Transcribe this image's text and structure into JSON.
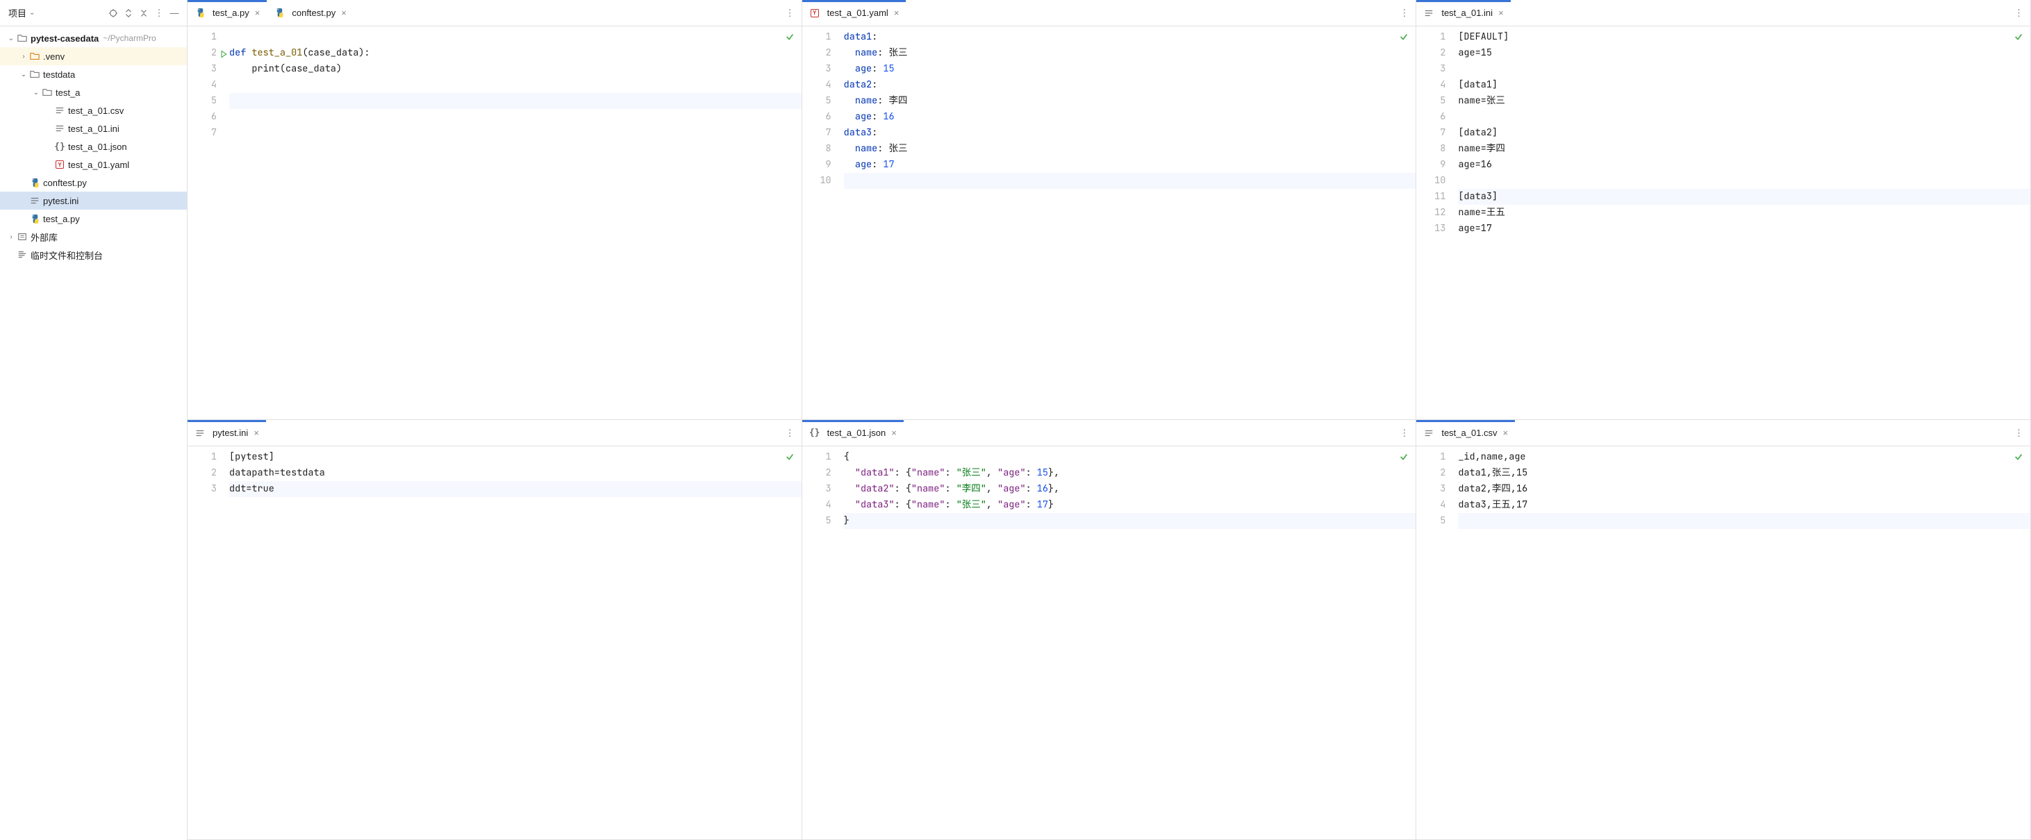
{
  "sidebar": {
    "title": "项目",
    "tree": [
      {
        "id": "root",
        "indent": 0,
        "caret": "open",
        "icon": "folder",
        "label": "pytest-casedata",
        "bold": true,
        "suffix": "~/PycharmPro",
        "hl": false,
        "sel": false
      },
      {
        "id": "venv",
        "indent": 1,
        "caret": "closed",
        "icon": "folder-exc",
        "label": ".venv",
        "bold": false,
        "suffix": "",
        "hl": true,
        "sel": false
      },
      {
        "id": "testdata",
        "indent": 1,
        "caret": "open",
        "icon": "folder",
        "label": "testdata",
        "bold": false,
        "suffix": "",
        "hl": false,
        "sel": false
      },
      {
        "id": "test_a",
        "indent": 2,
        "caret": "open",
        "icon": "folder",
        "label": "test_a",
        "bold": false,
        "suffix": "",
        "hl": false,
        "sel": false
      },
      {
        "id": "csv",
        "indent": 3,
        "caret": "",
        "icon": "lines",
        "label": "test_a_01.csv",
        "bold": false,
        "suffix": "",
        "hl": false,
        "sel": false
      },
      {
        "id": "ini",
        "indent": 3,
        "caret": "",
        "icon": "lines",
        "label": "test_a_01.ini",
        "bold": false,
        "suffix": "",
        "hl": false,
        "sel": false
      },
      {
        "id": "json",
        "indent": 3,
        "caret": "",
        "icon": "json",
        "label": "test_a_01.json",
        "bold": false,
        "suffix": "",
        "hl": false,
        "sel": false
      },
      {
        "id": "yaml",
        "indent": 3,
        "caret": "",
        "icon": "yaml",
        "label": "test_a_01.yaml",
        "bold": false,
        "suffix": "",
        "hl": false,
        "sel": false
      },
      {
        "id": "conftest",
        "indent": 1,
        "caret": "",
        "icon": "py",
        "label": "conftest.py",
        "bold": false,
        "suffix": "",
        "hl": false,
        "sel": false
      },
      {
        "id": "pytestini",
        "indent": 1,
        "caret": "",
        "icon": "lines",
        "label": "pytest.ini",
        "bold": false,
        "suffix": "",
        "hl": false,
        "sel": true
      },
      {
        "id": "test_a_py",
        "indent": 1,
        "caret": "",
        "icon": "py",
        "label": "test_a.py",
        "bold": false,
        "suffix": "",
        "hl": false,
        "sel": false
      },
      {
        "id": "ext",
        "indent": 0,
        "caret": "closed",
        "icon": "ext",
        "label": "外部库",
        "bold": false,
        "suffix": "",
        "hl": false,
        "sel": false
      },
      {
        "id": "scratch",
        "indent": 0,
        "caret": "",
        "icon": "scratch",
        "label": "临时文件和控制台",
        "bold": false,
        "suffix": "",
        "hl": false,
        "sel": false
      }
    ]
  },
  "panes": [
    {
      "tabs": [
        {
          "icon": "py",
          "label": "test_a.py",
          "active": true
        },
        {
          "icon": "py",
          "label": "conftest.py",
          "active": false
        }
      ],
      "check": true,
      "gutterExtra": {
        "2": "play"
      },
      "lines": [
        {
          "n": 1,
          "hl": false,
          "tokens": []
        },
        {
          "n": 2,
          "hl": false,
          "tokens": [
            {
              "c": "kw",
              "t": "def "
            },
            {
              "c": "fn",
              "t": "test_a_01"
            },
            {
              "c": "plain",
              "t": "(case_data):"
            }
          ]
        },
        {
          "n": 3,
          "hl": false,
          "tokens": [
            {
              "c": "plain",
              "t": "    print(case_data)"
            }
          ]
        },
        {
          "n": 4,
          "hl": false,
          "tokens": []
        },
        {
          "n": 5,
          "hl": true,
          "tokens": []
        },
        {
          "n": 6,
          "hl": false,
          "tokens": []
        },
        {
          "n": 7,
          "hl": false,
          "tokens": []
        }
      ]
    },
    {
      "tabs": [
        {
          "icon": "yaml",
          "label": "test_a_01.yaml",
          "active": true
        }
      ],
      "check": true,
      "lines": [
        {
          "n": 1,
          "hl": false,
          "tokens": [
            {
              "c": "key",
              "t": "data1"
            },
            {
              "c": "plain",
              "t": ":"
            }
          ]
        },
        {
          "n": 2,
          "hl": false,
          "tokens": [
            {
              "c": "plain",
              "t": "  "
            },
            {
              "c": "key",
              "t": "name"
            },
            {
              "c": "plain",
              "t": ": 张三"
            }
          ]
        },
        {
          "n": 3,
          "hl": false,
          "tokens": [
            {
              "c": "plain",
              "t": "  "
            },
            {
              "c": "key",
              "t": "age"
            },
            {
              "c": "plain",
              "t": ": "
            },
            {
              "c": "num",
              "t": "15"
            }
          ]
        },
        {
          "n": 4,
          "hl": false,
          "tokens": [
            {
              "c": "key",
              "t": "data2"
            },
            {
              "c": "plain",
              "t": ":"
            }
          ]
        },
        {
          "n": 5,
          "hl": false,
          "tokens": [
            {
              "c": "plain",
              "t": "  "
            },
            {
              "c": "key",
              "t": "name"
            },
            {
              "c": "plain",
              "t": ": 李四"
            }
          ]
        },
        {
          "n": 6,
          "hl": false,
          "tokens": [
            {
              "c": "plain",
              "t": "  "
            },
            {
              "c": "key",
              "t": "age"
            },
            {
              "c": "plain",
              "t": ": "
            },
            {
              "c": "num",
              "t": "16"
            }
          ]
        },
        {
          "n": 7,
          "hl": false,
          "tokens": [
            {
              "c": "key",
              "t": "data3"
            },
            {
              "c": "plain",
              "t": ":"
            }
          ]
        },
        {
          "n": 8,
          "hl": false,
          "tokens": [
            {
              "c": "plain",
              "t": "  "
            },
            {
              "c": "key",
              "t": "name"
            },
            {
              "c": "plain",
              "t": ": 张三"
            }
          ]
        },
        {
          "n": 9,
          "hl": false,
          "tokens": [
            {
              "c": "plain",
              "t": "  "
            },
            {
              "c": "key",
              "t": "age"
            },
            {
              "c": "plain",
              "t": ": "
            },
            {
              "c": "num",
              "t": "17"
            }
          ]
        },
        {
          "n": 10,
          "hl": true,
          "tokens": []
        }
      ]
    },
    {
      "tabs": [
        {
          "icon": "lines",
          "label": "test_a_01.ini",
          "active": true
        }
      ],
      "check": true,
      "lines": [
        {
          "n": 1,
          "hl": false,
          "tokens": [
            {
              "c": "plain",
              "t": "[DEFAULT]"
            }
          ]
        },
        {
          "n": 2,
          "hl": false,
          "tokens": [
            {
              "c": "plain",
              "t": "age=15"
            }
          ]
        },
        {
          "n": 3,
          "hl": false,
          "tokens": []
        },
        {
          "n": 4,
          "hl": false,
          "tokens": [
            {
              "c": "plain",
              "t": "[data1]"
            }
          ]
        },
        {
          "n": 5,
          "hl": false,
          "tokens": [
            {
              "c": "plain",
              "t": "name=张三"
            }
          ]
        },
        {
          "n": 6,
          "hl": false,
          "tokens": []
        },
        {
          "n": 7,
          "hl": false,
          "tokens": [
            {
              "c": "plain",
              "t": "[data2]"
            }
          ]
        },
        {
          "n": 8,
          "hl": false,
          "tokens": [
            {
              "c": "plain",
              "t": "name=李四"
            }
          ]
        },
        {
          "n": 9,
          "hl": false,
          "tokens": [
            {
              "c": "plain",
              "t": "age=16"
            }
          ]
        },
        {
          "n": 10,
          "hl": false,
          "tokens": []
        },
        {
          "n": 11,
          "hl": true,
          "tokens": [
            {
              "c": "plain",
              "t": "[data3]"
            }
          ]
        },
        {
          "n": 12,
          "hl": false,
          "tokens": [
            {
              "c": "plain",
              "t": "name=王五"
            }
          ]
        },
        {
          "n": 13,
          "hl": false,
          "tokens": [
            {
              "c": "plain",
              "t": "age=17"
            }
          ]
        }
      ]
    },
    {
      "tabs": [
        {
          "icon": "lines",
          "label": "pytest.ini",
          "active": true
        }
      ],
      "check": true,
      "lines": [
        {
          "n": 1,
          "hl": false,
          "tokens": [
            {
              "c": "plain",
              "t": "[pytest]"
            }
          ]
        },
        {
          "n": 2,
          "hl": false,
          "tokens": [
            {
              "c": "plain",
              "t": "datapath=testdata"
            }
          ]
        },
        {
          "n": 3,
          "hl": true,
          "tokens": [
            {
              "c": "plain",
              "t": "ddt=true"
            }
          ]
        }
      ]
    },
    {
      "tabs": [
        {
          "icon": "json",
          "label": "test_a_01.json",
          "active": true
        }
      ],
      "check": true,
      "lines": [
        {
          "n": 1,
          "hl": false,
          "tokens": [
            {
              "c": "plain",
              "t": "{"
            }
          ]
        },
        {
          "n": 2,
          "hl": false,
          "tokens": [
            {
              "c": "plain",
              "t": "  "
            },
            {
              "c": "prop",
              "t": "\"data1\""
            },
            {
              "c": "plain",
              "t": ": {"
            },
            {
              "c": "prop",
              "t": "\"name\""
            },
            {
              "c": "plain",
              "t": ": "
            },
            {
              "c": "str",
              "t": "\"张三\""
            },
            {
              "c": "plain",
              "t": ", "
            },
            {
              "c": "prop",
              "t": "\"age\""
            },
            {
              "c": "plain",
              "t": ": "
            },
            {
              "c": "num",
              "t": "15"
            },
            {
              "c": "plain",
              "t": "},"
            }
          ]
        },
        {
          "n": 3,
          "hl": false,
          "tokens": [
            {
              "c": "plain",
              "t": "  "
            },
            {
              "c": "prop",
              "t": "\"data2\""
            },
            {
              "c": "plain",
              "t": ": {"
            },
            {
              "c": "prop",
              "t": "\"name\""
            },
            {
              "c": "plain",
              "t": ": "
            },
            {
              "c": "str",
              "t": "\"李四\""
            },
            {
              "c": "plain",
              "t": ", "
            },
            {
              "c": "prop",
              "t": "\"age\""
            },
            {
              "c": "plain",
              "t": ": "
            },
            {
              "c": "num",
              "t": "16"
            },
            {
              "c": "plain",
              "t": "},"
            }
          ]
        },
        {
          "n": 4,
          "hl": false,
          "tokens": [
            {
              "c": "plain",
              "t": "  "
            },
            {
              "c": "prop",
              "t": "\"data3\""
            },
            {
              "c": "plain",
              "t": ": {"
            },
            {
              "c": "prop",
              "t": "\"name\""
            },
            {
              "c": "plain",
              "t": ": "
            },
            {
              "c": "str",
              "t": "\"张三\""
            },
            {
              "c": "plain",
              "t": ", "
            },
            {
              "c": "prop",
              "t": "\"age\""
            },
            {
              "c": "plain",
              "t": ": "
            },
            {
              "c": "num",
              "t": "17"
            },
            {
              "c": "plain",
              "t": "}"
            }
          ]
        },
        {
          "n": 5,
          "hl": true,
          "tokens": [
            {
              "c": "plain",
              "t": "}"
            }
          ]
        }
      ]
    },
    {
      "tabs": [
        {
          "icon": "lines",
          "label": "test_a_01.csv",
          "active": true
        }
      ],
      "check": true,
      "lines": [
        {
          "n": 1,
          "hl": false,
          "tokens": [
            {
              "c": "plain",
              "t": "_id,name,age"
            }
          ]
        },
        {
          "n": 2,
          "hl": false,
          "tokens": [
            {
              "c": "plain",
              "t": "data1,张三,15"
            }
          ]
        },
        {
          "n": 3,
          "hl": false,
          "tokens": [
            {
              "c": "plain",
              "t": "data2,李四,16"
            }
          ]
        },
        {
          "n": 4,
          "hl": false,
          "tokens": [
            {
              "c": "plain",
              "t": "data3,王五,17"
            }
          ]
        },
        {
          "n": 5,
          "hl": true,
          "tokens": []
        }
      ]
    }
  ]
}
